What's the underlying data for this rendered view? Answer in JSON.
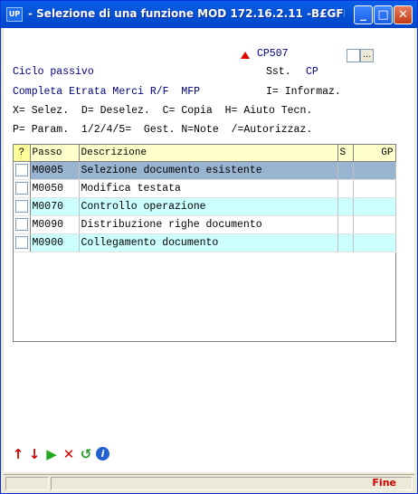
{
  "window": {
    "app_icon": "UP",
    "title": "- Selezione di una funzione MOD 172.16.2.11 -B£GFP...",
    "controls": {
      "minimize": "minimize-icon",
      "maximize": "maximize-icon",
      "close": "close-icon"
    }
  },
  "header": {
    "code": "CP507",
    "line1_left": "Ciclo passivo",
    "line1_right": "Sst.",
    "line1_right_value": "CP",
    "line2_left": "Completa Etrata Merci R/F  MFP",
    "line2_right": "I= Informaz.",
    "line3": "X= Selez.  D= Deselez.  C= Copia  H= Aiuto Tecn.",
    "line4": "P= Param.  1/2/4/5=  Gest. N=Note  /=Autorizzaz.",
    "dots_button": "..."
  },
  "grid": {
    "columns": [
      "?",
      "Passo",
      "Descrizione",
      "S",
      "GP"
    ],
    "rows": [
      {
        "passo": "M0005",
        "descrizione": "Selezione documento esistente",
        "s": "",
        "gp": ""
      },
      {
        "passo": "M0050",
        "descrizione": "Modifica testata",
        "s": "",
        "gp": ""
      },
      {
        "passo": "M0070",
        "descrizione": "Controllo operazione",
        "s": "",
        "gp": ""
      },
      {
        "passo": "M0090",
        "descrizione": "Distribuzione righe documento",
        "s": "",
        "gp": ""
      },
      {
        "passo": "M0900",
        "descrizione": "Collegamento documento",
        "s": "",
        "gp": ""
      }
    ]
  },
  "toolbar": {
    "up": "↑",
    "down": "↓",
    "run": "▶",
    "delete": "✕",
    "refresh": "↺",
    "info": "i"
  },
  "status": {
    "fine": "Fine"
  },
  "colors": {
    "accent": "#0054e3",
    "selected_row": "#99b4d1",
    "alt_row": "#ccffff",
    "header_text": "#000080"
  }
}
